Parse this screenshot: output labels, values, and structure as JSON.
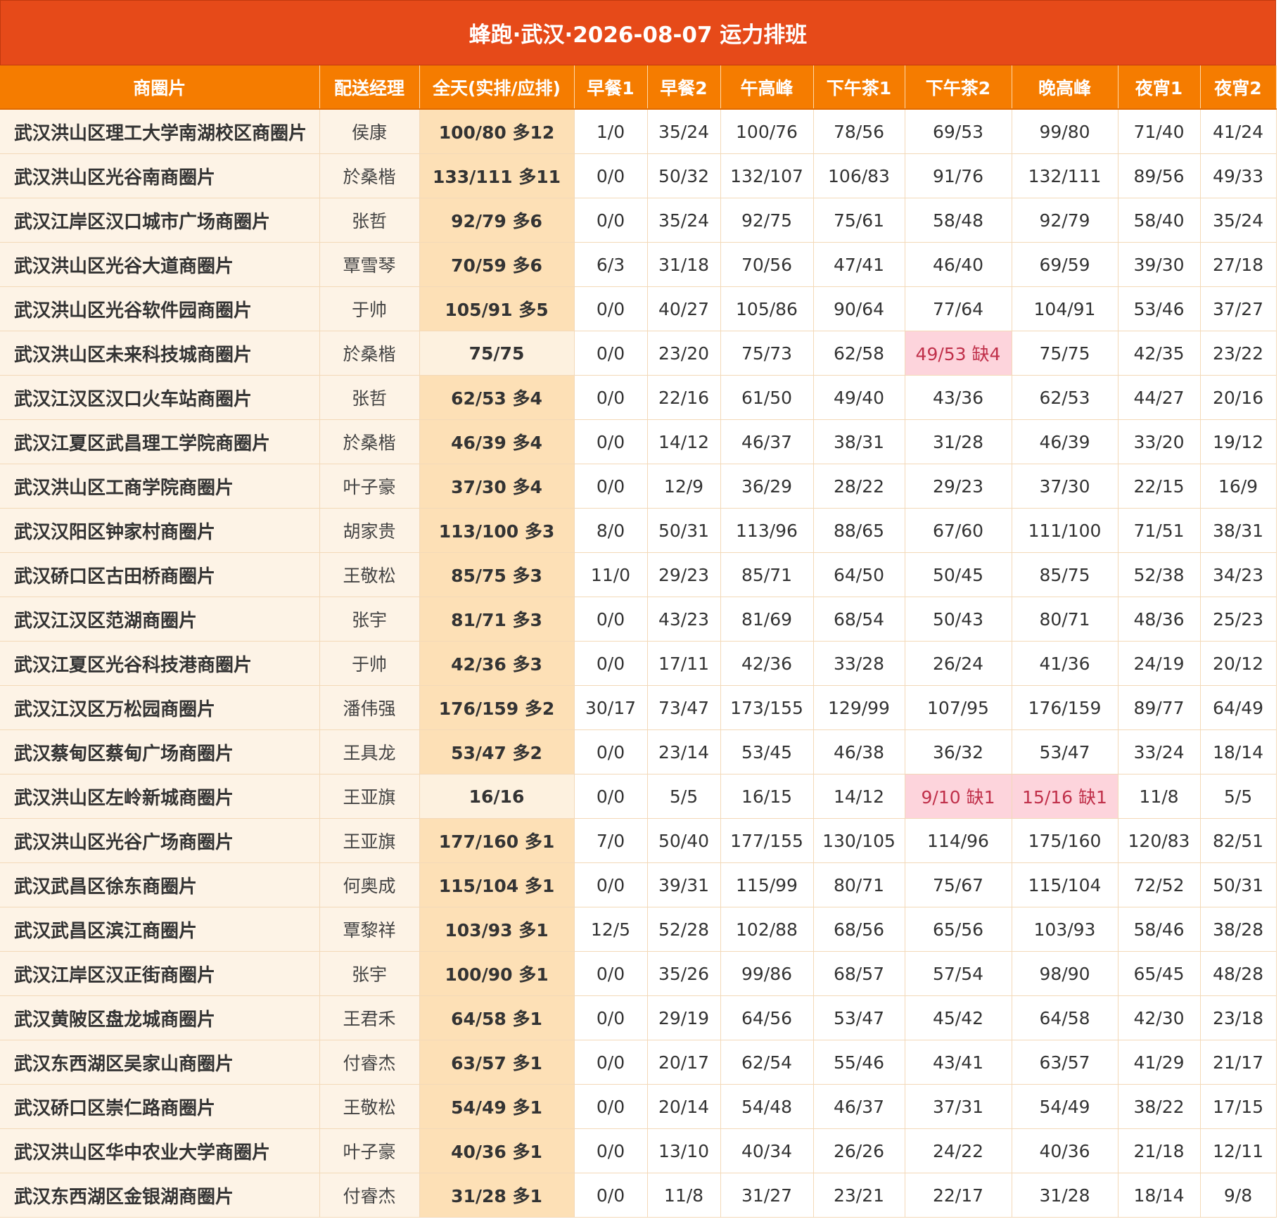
{
  "title": "蜂跑·武汉·2026-08-07 运力排班",
  "columns": [
    "商圈片",
    "配送经理",
    "全天(实排/应排)",
    "早餐1",
    "早餐2",
    "午高峰",
    "下午茶1",
    "下午茶2",
    "晚高峰",
    "夜宵1",
    "夜宵2"
  ],
  "colors": {
    "title_bg": "#e64a19",
    "header_bg": "#f57c00",
    "surplus_bg": "#fde0b6",
    "shortage_bg": "#fdd4dc",
    "shortage_text": "#c0304a"
  },
  "rows": [
    {
      "area": "武汉洪山区理工大学南湖校区商圈片",
      "manager": "侯康",
      "allday": "100/80 多12",
      "slots": [
        "1/0",
        "35/24",
        "100/76",
        "78/56",
        "69/53",
        "99/80",
        "71/40",
        "41/24"
      ]
    },
    {
      "area": "武汉洪山区光谷南商圈片",
      "manager": "於桑楷",
      "allday": "133/111 多11",
      "slots": [
        "0/0",
        "50/32",
        "132/107",
        "106/83",
        "91/76",
        "132/111",
        "89/56",
        "49/33"
      ]
    },
    {
      "area": "武汉江岸区汉口城市广场商圈片",
      "manager": "张哲",
      "allday": "92/79 多6",
      "slots": [
        "0/0",
        "35/24",
        "92/75",
        "75/61",
        "58/48",
        "92/79",
        "58/40",
        "35/24"
      ]
    },
    {
      "area": "武汉洪山区光谷大道商圈片",
      "manager": "覃雪琴",
      "allday": "70/59 多6",
      "slots": [
        "6/3",
        "31/18",
        "70/56",
        "47/41",
        "46/40",
        "69/59",
        "39/30",
        "27/18"
      ]
    },
    {
      "area": "武汉洪山区光谷软件园商圈片",
      "manager": "于帅",
      "allday": "105/91 多5",
      "slots": [
        "0/0",
        "40/27",
        "105/86",
        "90/64",
        "77/64",
        "104/91",
        "53/46",
        "37/27"
      ]
    },
    {
      "area": "武汉洪山区未来科技城商圈片",
      "manager": "於桑楷",
      "allday": "75/75",
      "slots": [
        "0/0",
        "23/20",
        "75/73",
        "62/58",
        "49/53 缺4",
        "75/75",
        "42/35",
        "23/22"
      ]
    },
    {
      "area": "武汉江汉区汉口火车站商圈片",
      "manager": "张哲",
      "allday": "62/53 多4",
      "slots": [
        "0/0",
        "22/16",
        "61/50",
        "49/40",
        "43/36",
        "62/53",
        "44/27",
        "20/16"
      ]
    },
    {
      "area": "武汉江夏区武昌理工学院商圈片",
      "manager": "於桑楷",
      "allday": "46/39 多4",
      "slots": [
        "0/0",
        "14/12",
        "46/37",
        "38/31",
        "31/28",
        "46/39",
        "33/20",
        "19/12"
      ]
    },
    {
      "area": "武汉洪山区工商学院商圈片",
      "manager": "叶子豪",
      "allday": "37/30 多4",
      "slots": [
        "0/0",
        "12/9",
        "36/29",
        "28/22",
        "29/23",
        "37/30",
        "22/15",
        "16/9"
      ]
    },
    {
      "area": "武汉汉阳区钟家村商圈片",
      "manager": "胡家贵",
      "allday": "113/100 多3",
      "slots": [
        "8/0",
        "50/31",
        "113/96",
        "88/65",
        "67/60",
        "111/100",
        "71/51",
        "38/31"
      ]
    },
    {
      "area": "武汉硚口区古田桥商圈片",
      "manager": "王敬松",
      "allday": "85/75 多3",
      "slots": [
        "11/0",
        "29/23",
        "85/71",
        "64/50",
        "50/45",
        "85/75",
        "52/38",
        "34/23"
      ]
    },
    {
      "area": "武汉江汉区范湖商圈片",
      "manager": "张宇",
      "allday": "81/71 多3",
      "slots": [
        "0/0",
        "43/23",
        "81/69",
        "68/54",
        "50/43",
        "80/71",
        "48/36",
        "25/23"
      ]
    },
    {
      "area": "武汉江夏区光谷科技港商圈片",
      "manager": "于帅",
      "allday": "42/36 多3",
      "slots": [
        "0/0",
        "17/11",
        "42/36",
        "33/28",
        "26/24",
        "41/36",
        "24/19",
        "20/12"
      ]
    },
    {
      "area": "武汉江汉区万松园商圈片",
      "manager": "潘伟强",
      "allday": "176/159 多2",
      "slots": [
        "30/17",
        "73/47",
        "173/155",
        "129/99",
        "107/95",
        "176/159",
        "89/77",
        "64/49"
      ]
    },
    {
      "area": "武汉蔡甸区蔡甸广场商圈片",
      "manager": "王具龙",
      "allday": "53/47 多2",
      "slots": [
        "0/0",
        "23/14",
        "53/45",
        "46/38",
        "36/32",
        "53/47",
        "33/24",
        "18/14"
      ]
    },
    {
      "area": "武汉洪山区左岭新城商圈片",
      "manager": "王亚旗",
      "allday": "16/16",
      "slots": [
        "0/0",
        "5/5",
        "16/15",
        "14/12",
        "9/10 缺1",
        "15/16 缺1",
        "11/8",
        "5/5"
      ]
    },
    {
      "area": "武汉洪山区光谷广场商圈片",
      "manager": "王亚旗",
      "allday": "177/160 多1",
      "slots": [
        "7/0",
        "50/40",
        "177/155",
        "130/105",
        "114/96",
        "175/160",
        "120/83",
        "82/51"
      ]
    },
    {
      "area": "武汉武昌区徐东商圈片",
      "manager": "何奥成",
      "allday": "115/104 多1",
      "slots": [
        "0/0",
        "39/31",
        "115/99",
        "80/71",
        "75/67",
        "115/104",
        "72/52",
        "50/31"
      ]
    },
    {
      "area": "武汉武昌区滨江商圈片",
      "manager": "覃黎祥",
      "allday": "103/93 多1",
      "slots": [
        "12/5",
        "52/28",
        "102/88",
        "68/56",
        "65/56",
        "103/93",
        "58/46",
        "38/28"
      ]
    },
    {
      "area": "武汉江岸区汉正街商圈片",
      "manager": "张宇",
      "allday": "100/90 多1",
      "slots": [
        "0/0",
        "35/26",
        "99/86",
        "68/57",
        "57/54",
        "98/90",
        "65/45",
        "48/28"
      ]
    },
    {
      "area": "武汉黄陂区盘龙城商圈片",
      "manager": "王君禾",
      "allday": "64/58 多1",
      "slots": [
        "0/0",
        "29/19",
        "64/56",
        "53/47",
        "45/42",
        "64/58",
        "42/30",
        "23/18"
      ]
    },
    {
      "area": "武汉东西湖区吴家山商圈片",
      "manager": "付睿杰",
      "allday": "63/57 多1",
      "slots": [
        "0/0",
        "20/17",
        "62/54",
        "55/46",
        "43/41",
        "63/57",
        "41/29",
        "21/17"
      ]
    },
    {
      "area": "武汉硚口区崇仁路商圈片",
      "manager": "王敬松",
      "allday": "54/49 多1",
      "slots": [
        "0/0",
        "20/14",
        "54/48",
        "46/37",
        "37/31",
        "54/49",
        "38/22",
        "17/15"
      ]
    },
    {
      "area": "武汉洪山区华中农业大学商圈片",
      "manager": "叶子豪",
      "allday": "40/36 多1",
      "slots": [
        "0/0",
        "13/10",
        "40/34",
        "26/26",
        "24/22",
        "40/36",
        "21/18",
        "12/11"
      ]
    },
    {
      "area": "武汉东西湖区金银湖商圈片",
      "manager": "付睿杰",
      "allday": "31/28 多1",
      "slots": [
        "0/0",
        "11/8",
        "31/27",
        "23/21",
        "22/17",
        "31/28",
        "18/14",
        "9/8"
      ]
    }
  ]
}
